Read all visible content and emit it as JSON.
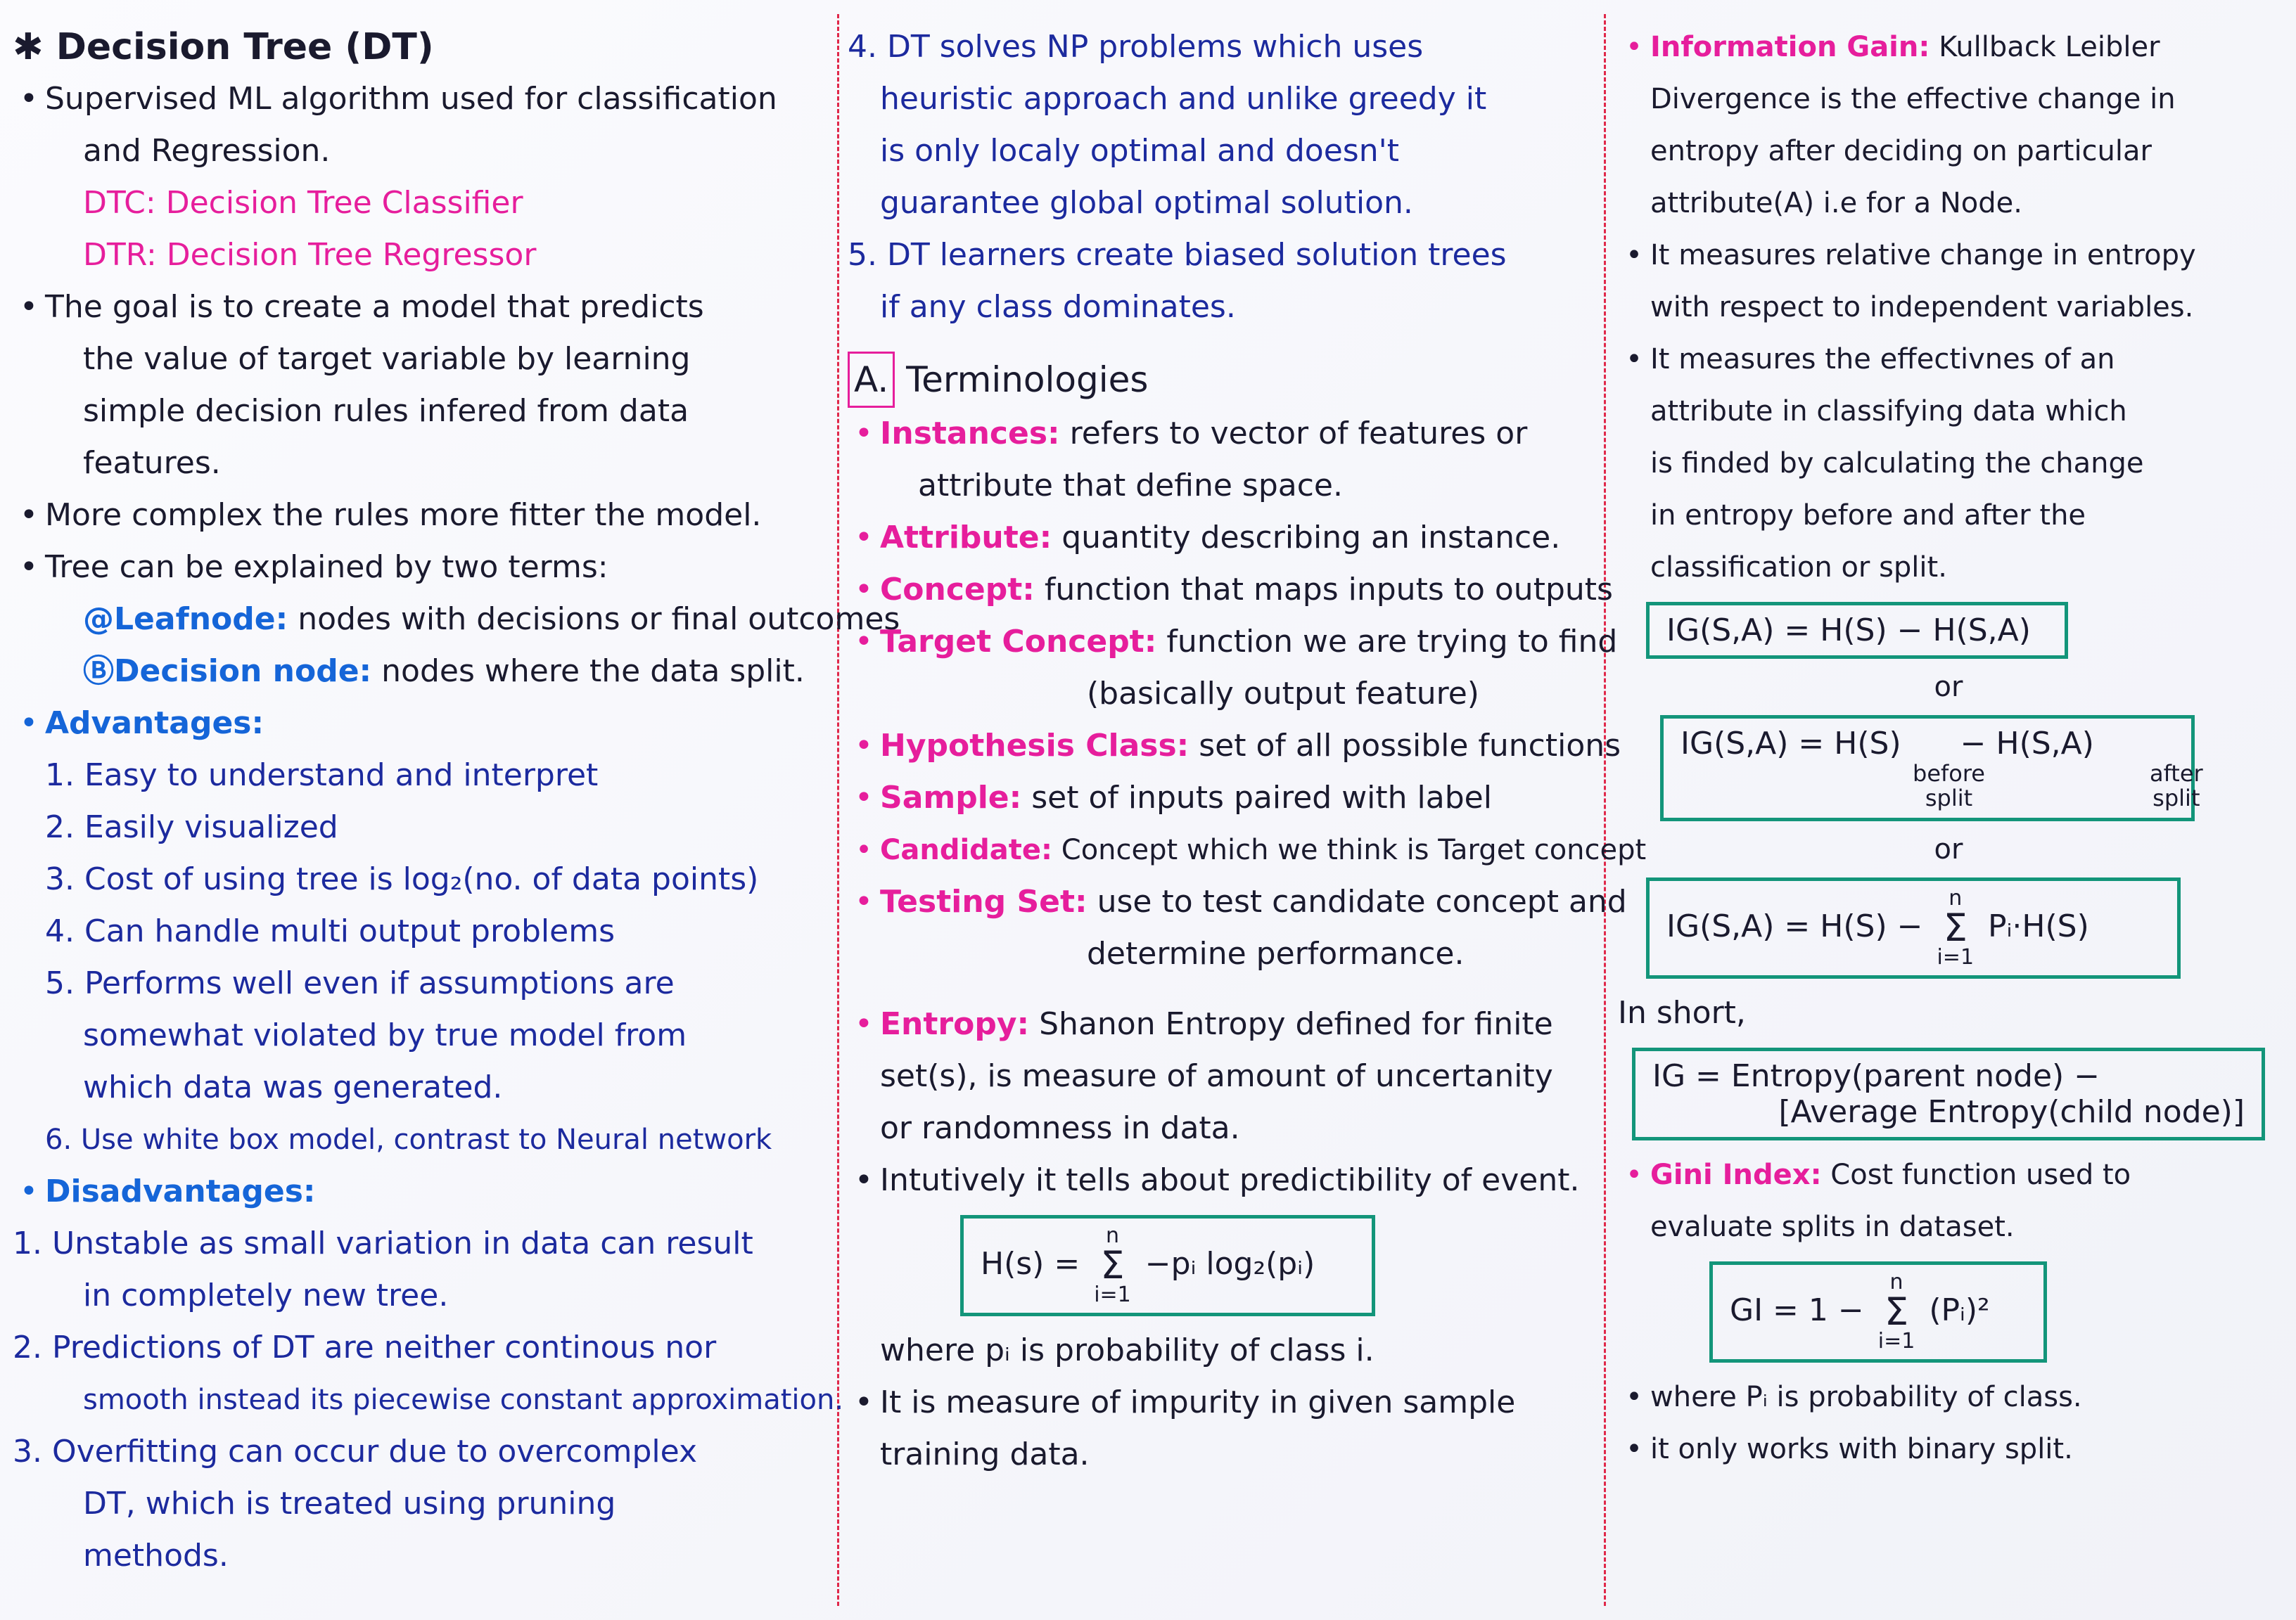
{
  "col1": {
    "title": "Decision Tree (DT)",
    "p1_l1": "Supervised ML algorithm used for classification",
    "p1_l2": "and Regression.",
    "dtc": "DTC: Decision Tree Classifier",
    "dtr": "DTR: Decision Tree Regressor",
    "p2_l1": "The goal is to create a model that predicts",
    "p2_l2": "the value of target variable by learning",
    "p2_l3": "simple decision rules infered from data",
    "p2_l4": "features.",
    "p3": "More complex the rules more fitter the model.",
    "p4": "Tree can be explained by two terms:",
    "leaf_term": "@Leafnode:",
    "leaf_desc": "nodes with decisions or final outcomes",
    "dec_term": "ⒷDecision node:",
    "dec_desc": "nodes where the data split.",
    "adv_title": "Advantages:",
    "adv": [
      "1. Easy to understand and interpret",
      "2. Easily visualized",
      "3. Cost of using tree is log₂(no. of data points)",
      "4. Can handle multi output problems",
      "5. Performs well even if assumptions are",
      "somewhat violated by true model from",
      "which data was generated.",
      "6. Use white box model, contrast to Neural network"
    ],
    "dis_title": "Disadvantages:",
    "dis": [
      "1. Unstable as small variation in data can result",
      "in completely new tree.",
      "2. Predictions of DT are neither continous nor",
      "smooth instead its piecewise constant approximation.",
      "3. Overfitting can occur due to overcomplex",
      "DT, which is treated using pruning",
      "methods."
    ]
  },
  "col2": {
    "p4": [
      "4. DT solves NP problems which uses",
      "heuristic approach and unlike greedy it",
      "is only localy optimal and doesn't",
      "guarantee global optimal solution."
    ],
    "p5": [
      "5. DT learners create biased solution trees",
      "if any class dominates."
    ],
    "sec_letter": "A.",
    "sec_title": "Terminologies",
    "instances_term": "Instances:",
    "instances_desc": "refers to vector of features or",
    "instances_desc2": "attribute that define space.",
    "attribute_term": "Attribute:",
    "attribute_desc": "quantity describing an instance.",
    "concept_term": "Concept:",
    "concept_desc": "function that maps inputs to outputs",
    "target_term": "Target Concept:",
    "target_desc": "function we are trying to find",
    "target_desc2": "(basically output feature)",
    "hyp_term": "Hypothesis Class:",
    "hyp_desc": "set of all possible functions",
    "sample_term": "Sample:",
    "sample_desc": "set of inputs paired with label",
    "cand_term": "Candidate:",
    "cand_desc": "Concept which we think is Target concept",
    "test_term": "Testing Set:",
    "test_desc": "use to test candidate concept and",
    "test_desc2": "determine performance.",
    "entropy_term": "Entropy:",
    "entropy_desc": "Shanon Entropy defined for finite",
    "entropy_desc2": "set(s), is measure of amount of uncertanity",
    "entropy_desc3": "or randomness in data.",
    "intuit": "Intutively it tells about predictibility of event.",
    "f_lhs": "H(s) =",
    "f_top": "n",
    "f_sym": "Σ",
    "f_bot": "i=1",
    "f_rhs": "−pᵢ log₂(pᵢ)",
    "where": "where pᵢ is probability of class i.",
    "impurity": "It is measure of impurity in given sample",
    "impurity2": "training data."
  },
  "col3": {
    "ig_term": "Information Gain:",
    "ig_desc": "Kullback Leibler",
    "ig_l2": "Divergence is the effective change in",
    "ig_l3": "entropy after deciding on particular",
    "ig_l4": "attribute(A) i.e for a Node.",
    "b1_l1": "It measures relative change in entropy",
    "b1_l2": "with respect to independent variables.",
    "b2_l1": "It measures the effectivnes of an",
    "b2_l2": "attribute in classifying data which",
    "b2_l3": "is finded by calculating the change",
    "b2_l4": "in entropy before and after the",
    "b2_l5": "classification or split.",
    "f1": "IG(S,A) = H(S) − H(S,A)",
    "or": "or",
    "f2_lhs": "IG(S,A) = H(S)",
    "f2_minus": "−",
    "f2_rhs": "H(S,A)",
    "f2_before": "before",
    "f2_split1": "split",
    "f2_after": "after",
    "f2_split2": "split",
    "f3_lhs": "IG(S,A) = H(S) −",
    "f3_top": "n",
    "f3_sym": "Σ",
    "f3_bot": "i=1",
    "f3_rhs": "Pᵢ·H(S)",
    "inshort": "In short,",
    "f4_l1": "IG = Entropy(parent node) −",
    "f4_l2": "[Average Entropy(child node)]",
    "gini_term": "Gini Index:",
    "gini_desc": "Cost function used to",
    "gini_desc2": "evaluate splits in dataset.",
    "f5_lhs": "GI = 1 −",
    "f5_top": "n",
    "f5_sym": "Σ",
    "f5_bot": "i=1",
    "f5_rhs": "(Pᵢ)²",
    "where": "where Pᵢ is probability of class.",
    "binary": "it only works with binary split."
  }
}
